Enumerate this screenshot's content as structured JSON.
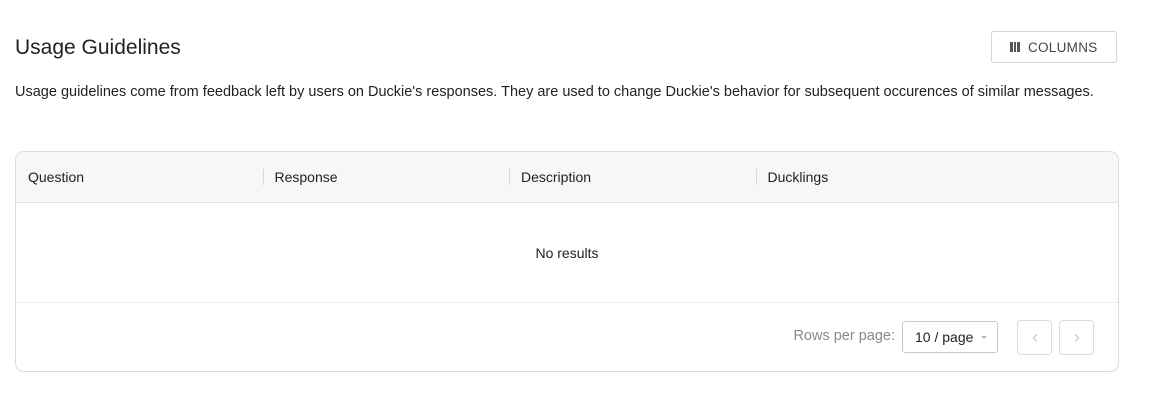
{
  "header": {
    "title": "Usage Guidelines",
    "columns_button_label": "COLUMNS",
    "columns_icon": "columns-icon"
  },
  "description": "Usage guidelines come from feedback left by users on Duckie's responses. They are used to change Duckie's behavior for subsequent occurences of similar messages.",
  "table": {
    "columns": [
      "Question",
      "Response",
      "Description",
      "Ducklings"
    ],
    "rows": [],
    "empty_text": "No results"
  },
  "pagination": {
    "rows_per_page_label": "Rows per page:",
    "page_size_selected": "10 / page",
    "prev_icon": "chevron-left-icon",
    "next_icon": "chevron-right-icon"
  }
}
